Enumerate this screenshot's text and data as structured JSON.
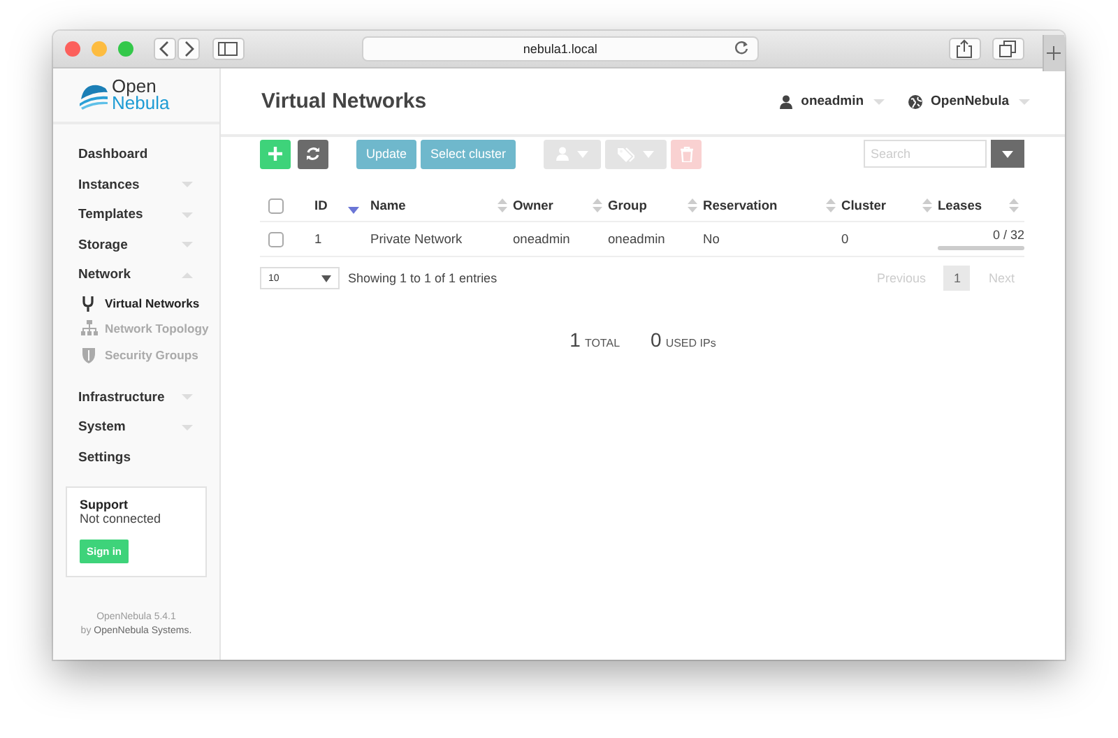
{
  "browser": {
    "url": "nebula1.local"
  },
  "sidebar": {
    "logo": [
      "Open",
      "Nebula"
    ],
    "items": [
      {
        "label": "Dashboard",
        "kind": "link"
      },
      {
        "label": "Instances",
        "kind": "group",
        "expanded": false
      },
      {
        "label": "Templates",
        "kind": "group",
        "expanded": false
      },
      {
        "label": "Storage",
        "kind": "group",
        "expanded": false
      },
      {
        "label": "Network",
        "kind": "group",
        "expanded": true,
        "children": [
          {
            "label": "Virtual Networks",
            "selected": true
          },
          {
            "label": "Network Topology",
            "selected": false
          },
          {
            "label": "Security Groups",
            "selected": false
          }
        ]
      },
      {
        "label": "Infrastructure",
        "kind": "group",
        "expanded": false
      },
      {
        "label": "System",
        "kind": "group",
        "expanded": false
      },
      {
        "label": "Settings",
        "kind": "link"
      }
    ],
    "support": {
      "title": "Support",
      "status": "Not connected",
      "button": "Sign in"
    },
    "footer": [
      "OpenNebula 5.4.1",
      "by ",
      "OpenNebula Systems."
    ]
  },
  "header": {
    "title": "Virtual Networks",
    "user": "oneadmin",
    "zone": "OpenNebula"
  },
  "toolbar": [
    {
      "kind": "create",
      "disabled": false
    },
    {
      "kind": "refresh",
      "disabled": false
    },
    {
      "kind": "gap"
    },
    {
      "kind": "text",
      "label": "Update",
      "disabled": true
    },
    {
      "kind": "text",
      "label": "Select cluster",
      "disabled": true
    },
    {
      "kind": "gap"
    },
    {
      "kind": "user-menu",
      "disabled": true
    },
    {
      "kind": "tag-menu",
      "disabled": true
    },
    {
      "kind": "delete",
      "disabled": true
    }
  ],
  "search": {
    "placeholder": "Search"
  },
  "table": {
    "all_checked": false,
    "columns": [
      {
        "label": "ID",
        "sorted": true
      },
      {
        "label": "Name",
        "sorted": false
      },
      {
        "label": "Owner",
        "sorted": false
      },
      {
        "label": "Group",
        "sorted": false
      },
      {
        "label": "Reservation",
        "sorted": false
      },
      {
        "label": "Cluster",
        "sorted": false
      },
      {
        "label": "Leases",
        "sorted": false
      }
    ],
    "rows": [
      {
        "checked": false,
        "cells": [
          "1",
          "Private Network",
          "oneadmin",
          "oneadmin",
          "No",
          "0"
        ],
        "leases": {
          "text": "0 / 32",
          "level": 0
        }
      }
    ]
  },
  "page_length": "10",
  "info": "Showing 1 to 1 of 1 entries",
  "pagination": [
    {
      "label": "Previous",
      "kind": "nav",
      "disabled": true
    },
    {
      "label": "1",
      "kind": "page",
      "selected": true
    },
    {
      "label": "Next",
      "kind": "nav",
      "disabled": true
    }
  ],
  "summary": [
    {
      "value": "1",
      "label": "TOTAL"
    },
    {
      "value": "0",
      "label": "USED IPs"
    }
  ]
}
